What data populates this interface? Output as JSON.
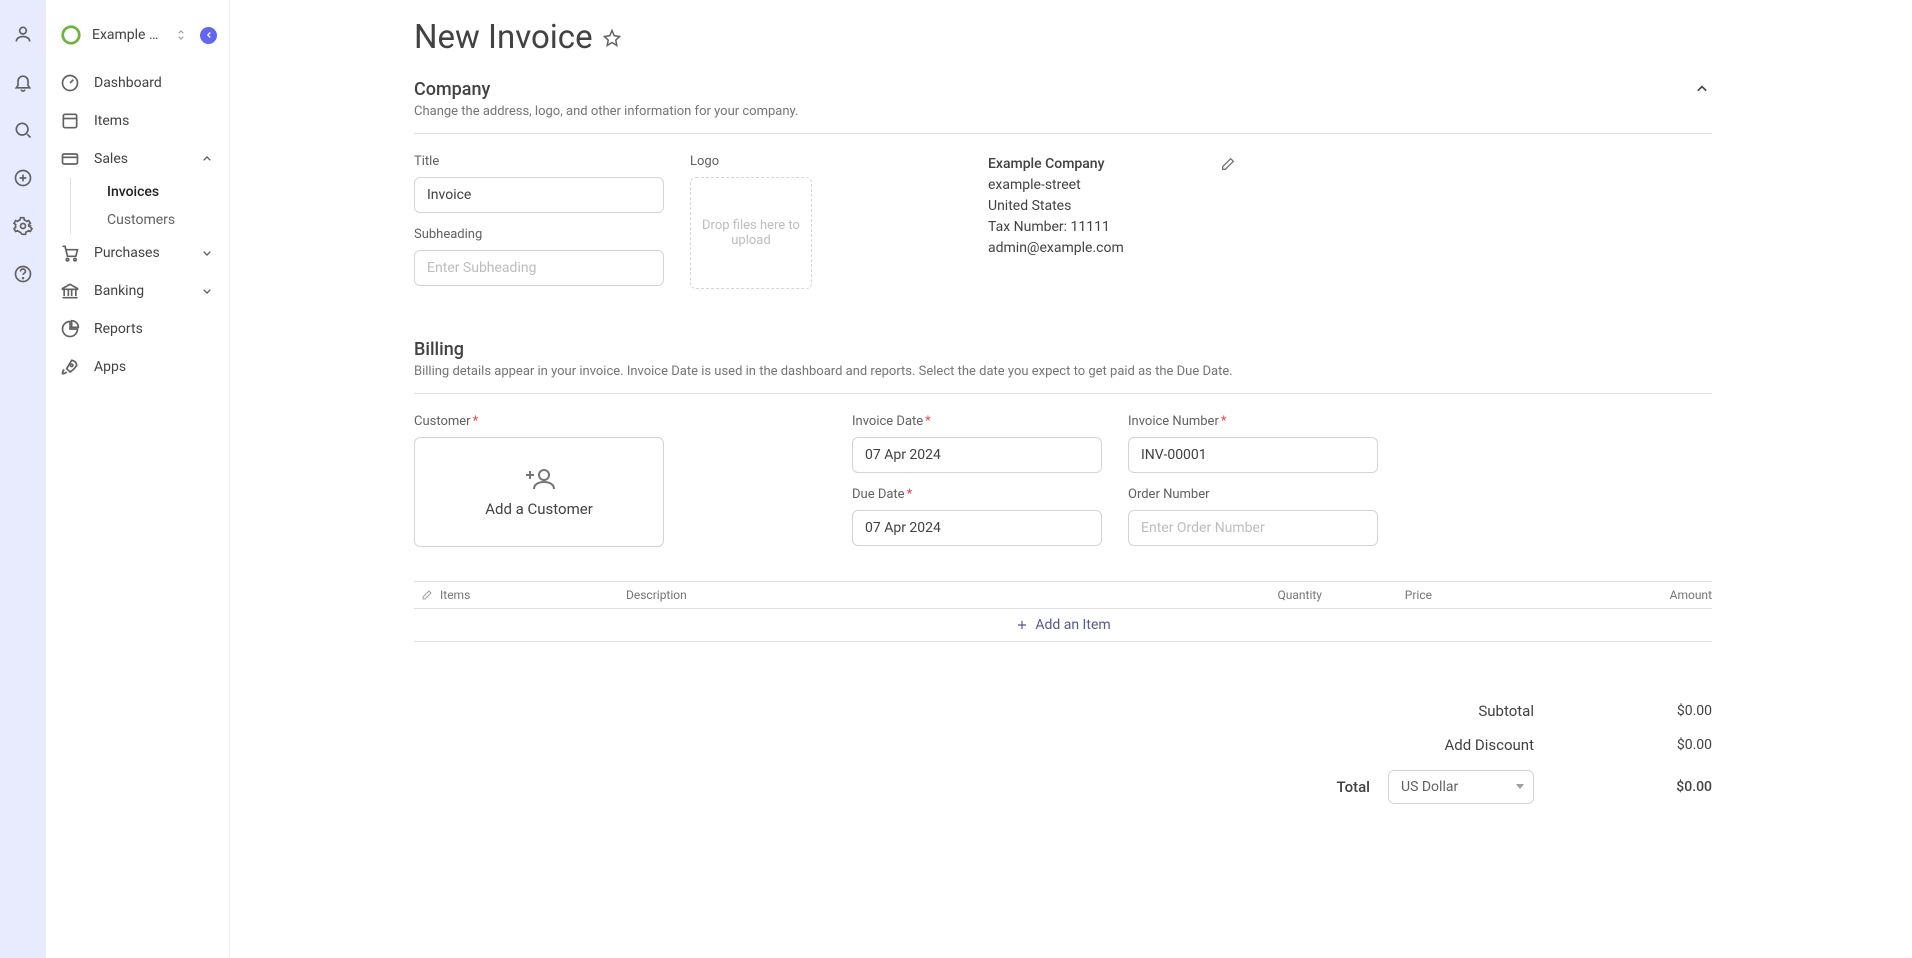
{
  "header": {
    "company_name": "Example Com…"
  },
  "sidebar": {
    "items": [
      {
        "label": "Dashboard"
      },
      {
        "label": "Items"
      },
      {
        "label": "Sales"
      },
      {
        "label": "Purchases"
      },
      {
        "label": "Banking"
      },
      {
        "label": "Reports"
      },
      {
        "label": "Apps"
      }
    ],
    "sales_sub": [
      {
        "label": "Invoices"
      },
      {
        "label": "Customers"
      }
    ]
  },
  "page": {
    "title": "New Invoice",
    "company_section": {
      "title": "Company",
      "subtitle": "Change the address, logo, and other information for your company.",
      "title_label": "Title",
      "title_value": "Invoice",
      "sub_label": "Subheading",
      "sub_placeholder": "Enter Subheading",
      "logo_label": "Logo",
      "dropzone_text": "Drop files here to upload",
      "info": {
        "name": "Example Company",
        "street": "example-street",
        "country": "United States",
        "tax": "Tax Number: 11111",
        "email": "admin@example.com"
      }
    },
    "billing_section": {
      "title": "Billing",
      "subtitle": "Billing details appear in your invoice. Invoice Date is used in the dashboard and reports. Select the date you expect to get paid as the Due Date.",
      "customer_label": "Customer",
      "add_customer": "Add a Customer",
      "invoice_date_label": "Invoice Date",
      "invoice_date_value": "07 Apr 2024",
      "due_date_label": "Due Date",
      "due_date_value": "07 Apr 2024",
      "invoice_number_label": "Invoice Number",
      "invoice_number_value": "INV-00001",
      "order_number_label": "Order Number",
      "order_number_placeholder": "Enter Order Number"
    },
    "items_table": {
      "headers": {
        "items": "Items",
        "description": "Description",
        "quantity": "Quantity",
        "price": "Price",
        "amount": "Amount"
      },
      "add_item": "Add an Item"
    },
    "totals": {
      "subtotal_label": "Subtotal",
      "subtotal_value": "$0.00",
      "discount_label": "Add Discount",
      "discount_value": "$0.00",
      "total_label": "Total",
      "currency": "US Dollar",
      "total_value": "$0.00"
    }
  }
}
